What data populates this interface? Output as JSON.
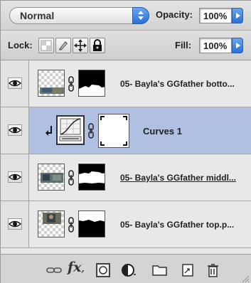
{
  "blend_mode": {
    "value": "Normal"
  },
  "opacity": {
    "label": "Opacity:",
    "value": "100%"
  },
  "lock": {
    "label": "Lock:"
  },
  "fill": {
    "label": "Fill:",
    "value": "100%"
  },
  "layers": [
    {
      "name": "05- Bayla's GGfather botto...",
      "selected": false,
      "underlined": false
    },
    {
      "name": "Curves 1",
      "selected": true,
      "underlined": false
    },
    {
      "name": "05- Bayla's GGfather middl...",
      "selected": false,
      "underlined": true
    },
    {
      "name": "05- Bayla's GGfather top.p...",
      "selected": false,
      "underlined": false
    }
  ],
  "bottom_bar": {
    "icons": [
      "link-layers-icon",
      "layer-style-fx-icon",
      "add-mask-icon",
      "adjustment-layer-icon",
      "new-group-icon",
      "new-layer-icon",
      "delete-layer-icon"
    ],
    "fx_text": "fx"
  },
  "colors": {
    "selected_row": "#afc0e2",
    "accent_blue": "#2b6fd6"
  }
}
